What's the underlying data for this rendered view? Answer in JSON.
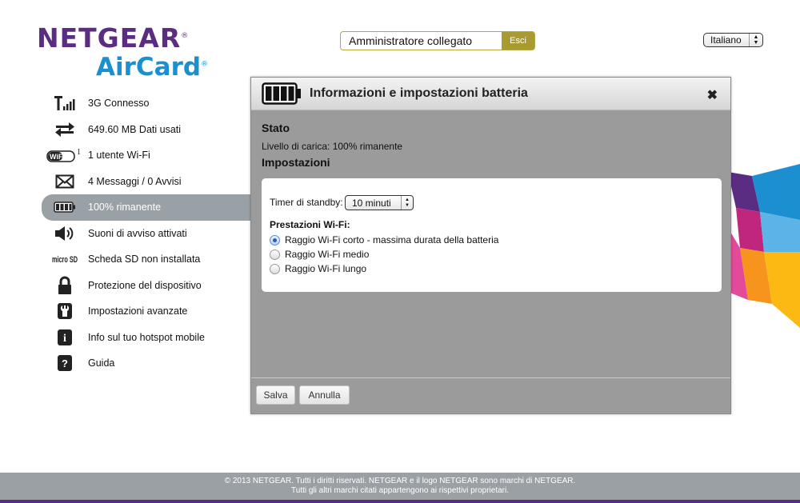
{
  "logo": {
    "brand": "NETGEAR",
    "product": "AirCard",
    "reg": "®"
  },
  "header": {
    "admin_status": "Amministratore collegato",
    "logout_label": "Esci",
    "language": "Italiano"
  },
  "sidebar": {
    "items": [
      {
        "label": "3G Connesso",
        "icon": "signal-icon"
      },
      {
        "label": "649.60 MB Dati usati",
        "icon": "data-transfer-icon"
      },
      {
        "label": "1 utente Wi-Fi",
        "icon": "wifi-icon",
        "badge": "1",
        "icon_text": "WiFi"
      },
      {
        "label": "4 Messaggi / 0 Avvisi",
        "icon": "envelope-icon"
      },
      {
        "label": "100% rimanente",
        "icon": "battery-icon",
        "active": true
      },
      {
        "label": "Suoni di avviso attivati",
        "icon": "speaker-icon"
      },
      {
        "label": "Scheda SD non installata",
        "icon": "microsd-icon",
        "icon_text": "micro SD"
      },
      {
        "label": "Protezione del dispositivo",
        "icon": "lock-icon"
      },
      {
        "label": "Impostazioni avanzate",
        "icon": "wrench-icon"
      },
      {
        "label": "Info sul tuo hotspot mobile",
        "icon": "info-icon",
        "icon_text": "i"
      },
      {
        "label": "Guida",
        "icon": "help-icon",
        "icon_text": "?"
      }
    ]
  },
  "dialog": {
    "title": "Informazioni e impostazioni batteria",
    "close_glyph": "✖",
    "status_heading": "Stato",
    "charge_level": "Livello di carica: 100% rimanente",
    "settings_heading": "Impostazioni",
    "standby_label": "Timer di standby:",
    "standby_value": "10 minuti",
    "wifi_perf_label": "Prestazioni Wi-Fi:",
    "wifi_options": [
      {
        "label": "Raggio Wi-Fi corto - massima durata della batteria",
        "checked": true
      },
      {
        "label": "Raggio Wi-Fi medio",
        "checked": false
      },
      {
        "label": "Raggio Wi-Fi lungo",
        "checked": false
      }
    ],
    "save_label": "Salva",
    "cancel_label": "Annulla"
  },
  "footer": {
    "line1": "© 2013 NETGEAR. Tutti i diritti riservati. NETGEAR e il logo NETGEAR sono marchi di NETGEAR.",
    "line2": "Tutti gli altri marchi citati appartengono ai rispettivi proprietari."
  },
  "colors": {
    "brand_purple": "#5a2d82",
    "brand_blue": "#1b8fd0",
    "logout_gold": "#a99a32",
    "dialog_gray": "#9b9b9b",
    "footer_gray": "#9ba0a5"
  }
}
